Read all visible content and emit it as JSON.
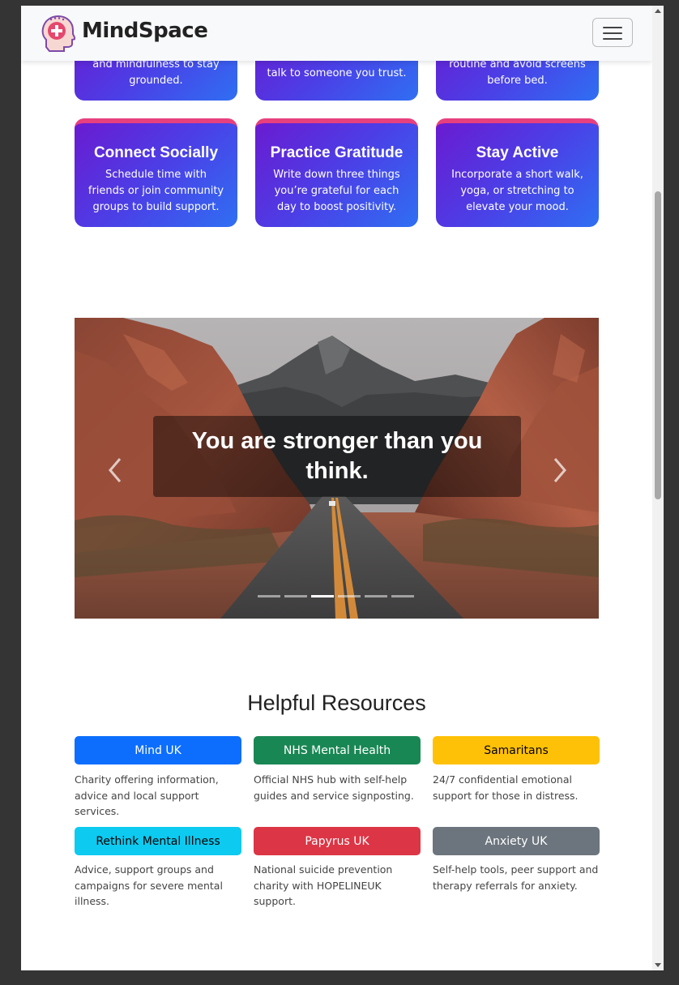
{
  "navbar": {
    "brand": "MindSpace",
    "logo_icon": "head-plus-icon",
    "menu_icon": "hamburger-icon"
  },
  "tips_partial": [
    {
      "text": "and mindfulness to stay grounded."
    },
    {
      "text": "talk to someone you trust."
    },
    {
      "text": "routine and avoid screens before bed."
    }
  ],
  "tips": [
    {
      "title": "Connect Socially",
      "text": "Schedule time with friends or join community groups to build support."
    },
    {
      "title": "Practice Gratitude",
      "text": "Write down three things you’re grateful for each day to boost positivity."
    },
    {
      "title": "Stay Active",
      "text": "Incorporate a short walk, yoga, or stretching to elevate your mood."
    }
  ],
  "carousel": {
    "caption": "You are stronger than you think.",
    "prev_icon": "chevron-left-icon",
    "next_icon": "chevron-right-icon",
    "slide_count": 6,
    "active_index": 2
  },
  "resources": {
    "heading": "Helpful Resources",
    "items": [
      {
        "label": "Mind UK",
        "desc": "Charity offering information, advice and local support services.",
        "color": "#0d6efd",
        "text_color": "#ffffff"
      },
      {
        "label": "NHS Mental Health",
        "desc": "Official NHS hub with self-help guides and service signposting.",
        "color": "#198754",
        "text_color": "#ffffff"
      },
      {
        "label": "Samaritans",
        "desc": "24/7 confidential emotional support for those in distress.",
        "color": "#ffc107",
        "text_color": "#000000"
      },
      {
        "label": "Rethink Mental Illness",
        "desc": "Advice, support groups and campaigns for severe mental illness.",
        "color": "#0dcaf0",
        "text_color": "#000000"
      },
      {
        "label": "Papyrus UK",
        "desc": "National suicide prevention charity with HOPELINEUK support.",
        "color": "#dc3545",
        "text_color": "#ffffff"
      },
      {
        "label": "Anxiety UK",
        "desc": "Self-help tools, peer support and therapy referrals for anxiety.",
        "color": "#6c757d",
        "text_color": "#ffffff"
      }
    ]
  }
}
